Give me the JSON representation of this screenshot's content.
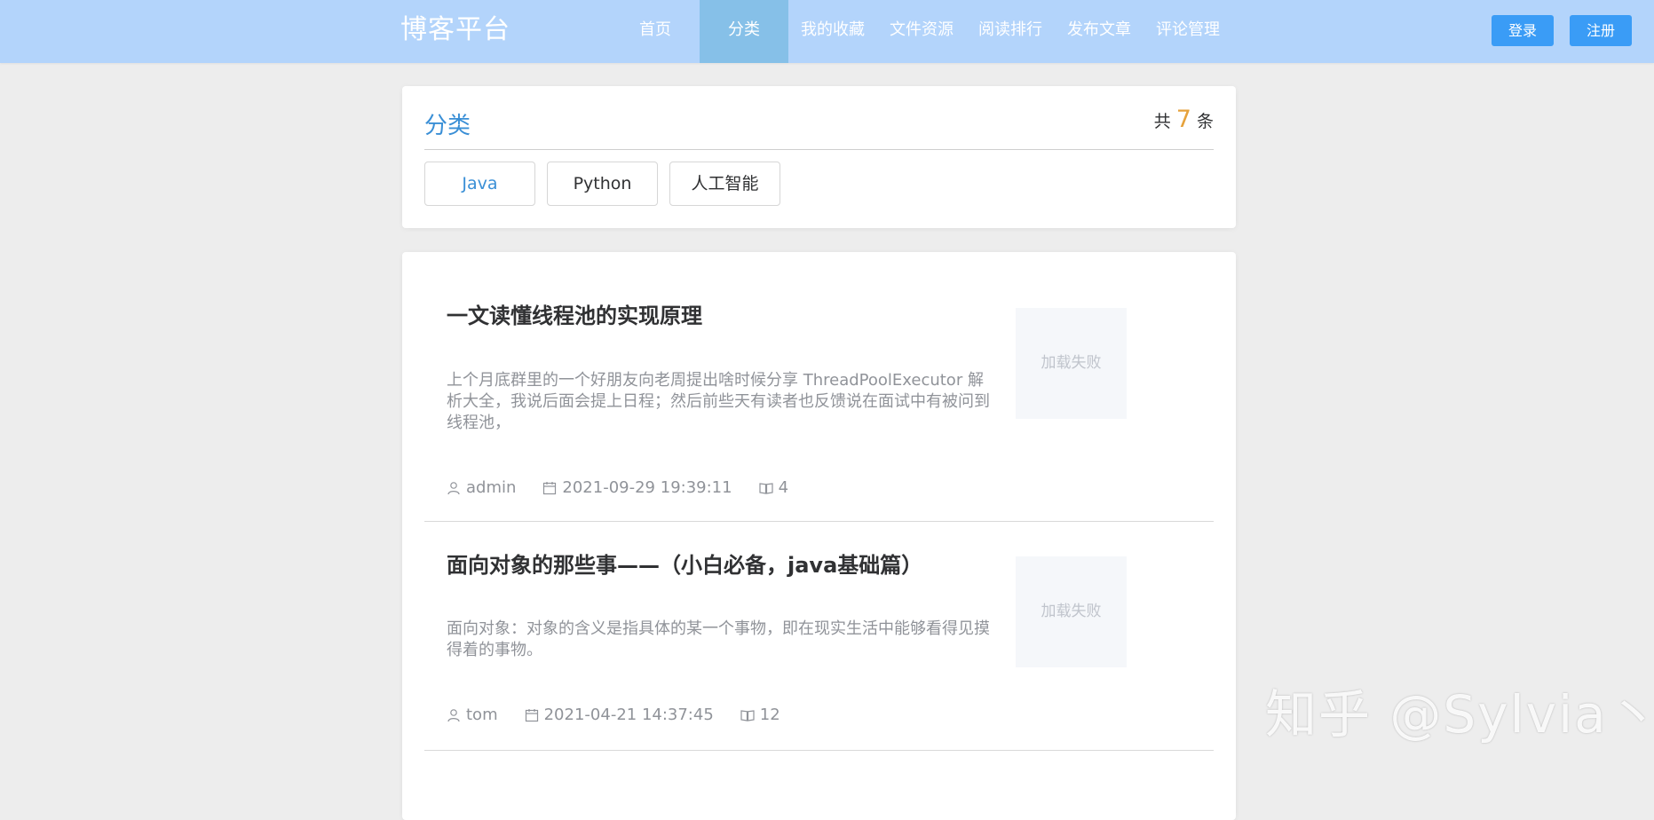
{
  "header": {
    "logo": "博客平台",
    "nav": [
      "首页",
      "分类",
      "我的收藏",
      "文件资源",
      "阅读排行",
      "发布文章",
      "评论管理"
    ],
    "active_index": 1,
    "login": "登录",
    "register": "注册"
  },
  "category": {
    "title": "分类",
    "count_prefix": "共",
    "count": "7",
    "count_suffix": "条",
    "tags": [
      "Java",
      "Python",
      "人工智能"
    ],
    "selected_tag": "Java"
  },
  "articles": [
    {
      "title": "一文读懂线程池的实现原理",
      "desc": "上个月底群里的一个好朋友向老周提出啥时候分享 ThreadPoolExecutor 解析大全，我说后面会提上日程；然后前些天有读者也反馈说在面试中有被问到线程池，",
      "thumb": "加载失败",
      "author": "admin",
      "date": "2021-09-29 19:39:11",
      "views": "4"
    },
    {
      "title": "面向对象的那些事——（小白必备，java基础篇）",
      "desc": "面向对象：对象的含义是指具体的某一个事物，即在现实生活中能够看得见摸得着的事物。",
      "thumb": "加载失败",
      "author": "tom",
      "date": "2021-04-21 14:37:45",
      "views": "12"
    }
  ],
  "watermark": "知乎 @Sylvia丶",
  "colors": {
    "header_bg": "#b3d4fb",
    "nav_active_bg": "#86c0e8",
    "button_blue": "#3a9cf6",
    "accent_blue": "#3a8fd6",
    "count_orange": "#e6a23c"
  }
}
